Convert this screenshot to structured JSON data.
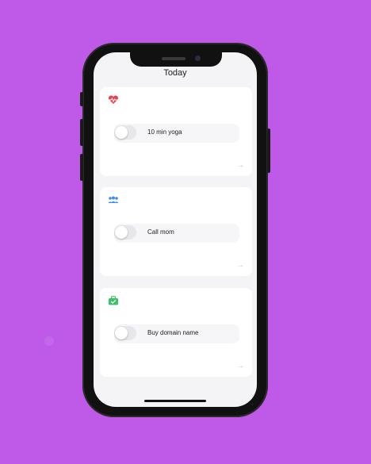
{
  "header": {
    "title": "Today"
  },
  "tasks": [
    {
      "label": "10 min yoga",
      "category_icon": "heart-pulse-icon",
      "icon_color": "#e8424f",
      "done": false
    },
    {
      "label": "Call mom",
      "category_icon": "people-icon",
      "icon_color": "#3d8ee8",
      "done": false
    },
    {
      "label": "Buy domain name",
      "category_icon": "briefcase-check-icon",
      "icon_color": "#3fbf68",
      "done": false
    }
  ],
  "icons": {
    "card_action": "arrow-right-icon"
  }
}
